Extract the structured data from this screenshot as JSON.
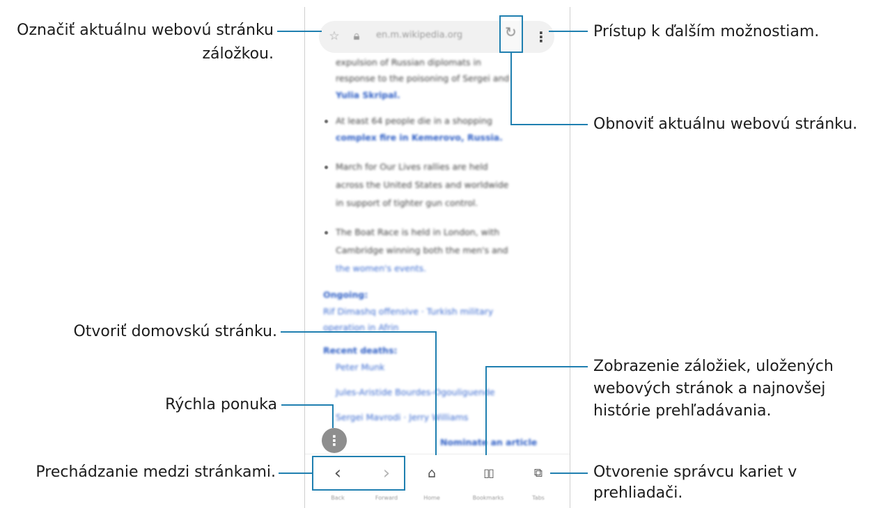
{
  "callouts": {
    "bookmark": [
      "Označiť aktuálnu webovú stránku",
      "záložkou."
    ],
    "more_options": "Prístup k ďalším možnostiam.",
    "refresh": "Obnoviť aktuálnu webovú stránku.",
    "home": "Otvoriť domovskú stránku.",
    "bookmarks_view": [
      "Zobrazenie záložiek, uložených",
      "webových stránok a najnovšej",
      "histórie prehľadávania."
    ],
    "quick_menu": "Rýchla ponuka",
    "navigate": "Prechádzanie medzi stránkami.",
    "tabs": [
      "Otvorenie správcu kariet v",
      "prehliadači."
    ]
  },
  "browser": {
    "url": "en.m.wikipedia.org",
    "icons": {
      "bookmark": "star-icon",
      "secure": "lock-icon",
      "refresh": "refresh-icon",
      "more": "more-vertical-icon",
      "quick_menu": "quick-menu-icon",
      "back": "back-arrow-icon",
      "forward": "forward-arrow-icon",
      "home": "home-icon",
      "bookmarks": "bookmarks-icon",
      "tabs": "tabs-icon"
    },
    "bottom_labels": {
      "back": "Back",
      "forward": "Forward",
      "home": "Home",
      "bookmarks": "Bookmarks",
      "tabs": "Tabs"
    }
  },
  "page_content": {
    "lines": [
      "expulsion of Russian diplomats in",
      "response to the poisoning of Sergei and",
      "Yulia Skripal.",
      "At least 64 people die in a shopping",
      "complex fire in Kemerovo, Russia.",
      "March for Our Lives rallies are held",
      "across the United States and worldwide",
      "in support of tighter gun control.",
      "The Boat Race is held in London, with",
      "Cambridge winning both the men's and",
      "the women's events.",
      "Ongoing:",
      "Rif Dimashq offensive · Turkish military",
      "operation in Afrin",
      "Recent deaths:",
      "Peter Munk",
      "Jules-Aristide Bourdes-Ogouliguende",
      "Sergei Mavrodi · Jerry Williams",
      "Nominate an article"
    ]
  },
  "colors": {
    "accent": "#1f7fb0",
    "link": "#2f5fc5",
    "fab": "#8e8e8e"
  }
}
